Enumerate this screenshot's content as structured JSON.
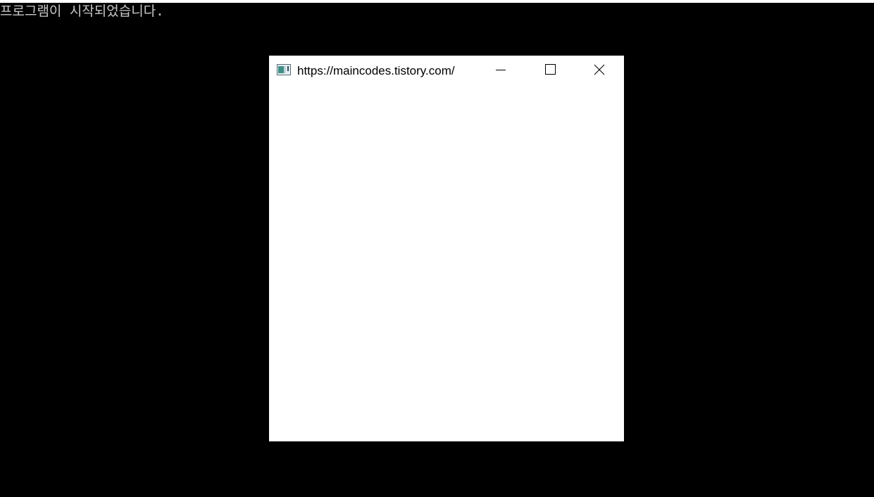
{
  "console": {
    "message": "프로그램이 시작되었습니다."
  },
  "window": {
    "title": "https://maincodes.tistory.com/",
    "icon": "app-window-icon",
    "controls": {
      "minimize": "minimize-icon",
      "maximize": "maximize-icon",
      "close": "close-icon"
    }
  },
  "colors": {
    "console_background": "#000000",
    "console_text": "#c8c8c8",
    "window_background": "#ffffff",
    "title_text": "#000000"
  }
}
